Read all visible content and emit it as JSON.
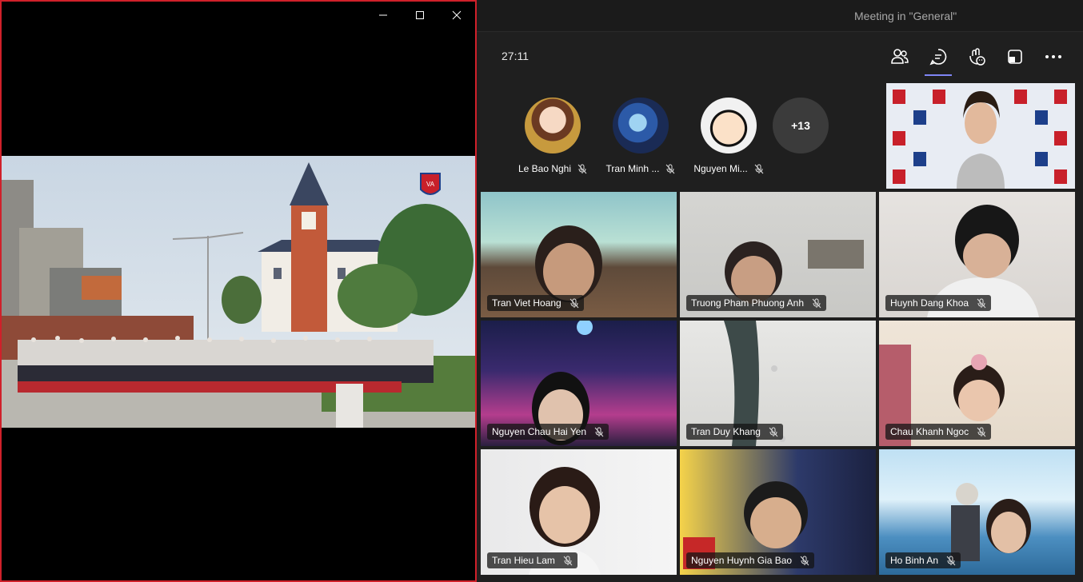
{
  "window": {
    "minimize_glyph": "—",
    "maximize_glyph": "☐",
    "close_glyph": "✕"
  },
  "photo": {
    "logo_text": "VA"
  },
  "meeting": {
    "title": "Meeting in \"General\"",
    "timer": "27:11"
  },
  "toolbar": {
    "icons": [
      "people-icon",
      "chat-icon",
      "reactions-icon",
      "share-tray-icon",
      "more-options-icon"
    ]
  },
  "avatars": [
    {
      "name": "Le Bao Nghi"
    },
    {
      "name": "Tran Minh ..."
    },
    {
      "name": "Nguyen Mi..."
    }
  ],
  "overflow_count": "+13",
  "participants": [
    {
      "name": "Tran Viet Hoang"
    },
    {
      "name": "Truong Pham Phuong Anh"
    },
    {
      "name": "Huynh Dang Khoa"
    },
    {
      "name": "Nguyen Chau Hai Yen"
    },
    {
      "name": "Tran Duy Khang"
    },
    {
      "name": "Chau Khanh Ngoc"
    },
    {
      "name": "Tran Hieu Lam"
    },
    {
      "name": "Nguyen Huynh Gia Bao"
    },
    {
      "name": "Ho Binh An"
    }
  ],
  "colors": {
    "accent": "#7f85f5",
    "frame_red": "#d0202a",
    "background": "#1f1f1f"
  }
}
